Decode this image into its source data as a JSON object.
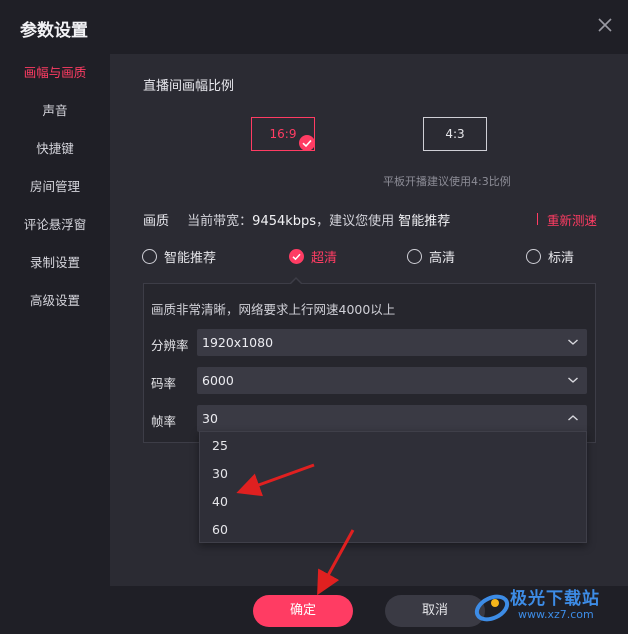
{
  "dialog": {
    "title": "参数设置"
  },
  "sidebar": {
    "items": [
      {
        "label": "画幅与画质",
        "active": true
      },
      {
        "label": "声音"
      },
      {
        "label": "快捷键"
      },
      {
        "label": "房间管理"
      },
      {
        "label": "评论悬浮窗"
      },
      {
        "label": "录制设置"
      },
      {
        "label": "高级设置"
      }
    ]
  },
  "ratio": {
    "title": "直播间画幅比例",
    "options": [
      "16:9",
      "4:3"
    ],
    "selected": "16:9",
    "hint": "平板开播建议使用4:3比例"
  },
  "quality": {
    "label": "画质",
    "bandwidth_prefix": "当前带宽：",
    "bandwidth_value": "9454kbps",
    "suggest_prefix": "，建议您使用",
    "suggest_value": "智能推荐",
    "retest": "重新测速",
    "options": [
      "智能推荐",
      "超清",
      "高清",
      "标清"
    ],
    "selected": "超清",
    "description": "画质非常清晰，网络要求上行网速4000以上",
    "resolution_label": "分辨率",
    "resolution_value": "1920x1080",
    "bitrate_label": "码率",
    "bitrate_value": "6000",
    "framerate_label": "帧率",
    "framerate_value": "30",
    "framerate_options": [
      "25",
      "30",
      "40",
      "60"
    ]
  },
  "footer": {
    "ok": "确定",
    "cancel": "取消"
  },
  "watermark": {
    "text": "极光下载站",
    "sub": "www.xz7.com"
  },
  "colors": {
    "accent": "#ff3c63",
    "background": "#1f1f26",
    "content": "#2b2b33",
    "annotation_arrow": "#e02020"
  }
}
